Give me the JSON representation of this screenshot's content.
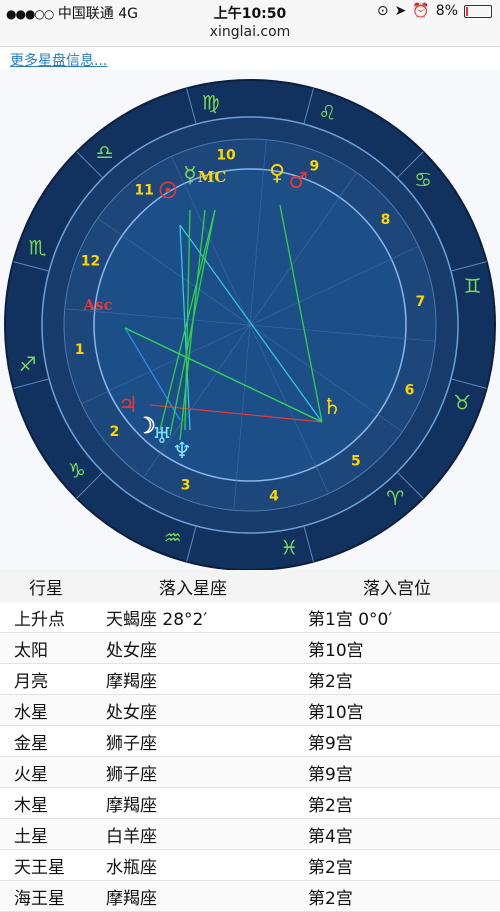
{
  "status": {
    "carrier": "中国联通",
    "network": "4G",
    "time": "上午10:50",
    "battery": "8%",
    "battery_level": 0.08
  },
  "url": "xinglai.com",
  "link_more": "更多星盘信息...",
  "chart": {
    "signs": [
      "♍",
      "♌",
      "♋",
      "♊",
      "♉",
      "♈",
      "♓",
      "♒",
      "♑",
      "♐",
      "♏",
      "♎"
    ],
    "house_numbers": [
      "1",
      "2",
      "3",
      "4",
      "5",
      "6",
      "7",
      "8",
      "9",
      "10",
      "11",
      "12"
    ],
    "planets": [
      {
        "glyph": "Asc",
        "color": "#e53935"
      },
      {
        "glyph": "☉",
        "color": "#e53935"
      },
      {
        "glyph": "MC",
        "color": "#ffd400"
      },
      {
        "glyph": "♀",
        "color": "#ffd400"
      },
      {
        "glyph": "♂",
        "color": "#e53935"
      },
      {
        "glyph": "☿",
        "color": "#7ed957"
      },
      {
        "glyph": "♃",
        "color": "#e53935"
      },
      {
        "glyph": "☽",
        "color": "#ffffff"
      },
      {
        "glyph": "♅",
        "color": "#7ee0ff"
      },
      {
        "glyph": "♆",
        "color": "#7ee0ff"
      },
      {
        "glyph": "♄",
        "color": "#ffd400"
      }
    ]
  },
  "table": {
    "headers": [
      "行星",
      "落入星座",
      "落入宫位"
    ],
    "rows": [
      [
        "上升点",
        "天蝎座 28°2′",
        "第1宫 0°0′"
      ],
      [
        "太阳",
        "处女座",
        "第10宫"
      ],
      [
        "月亮",
        "摩羯座",
        "第2宫"
      ],
      [
        "水星",
        "处女座",
        "第10宫"
      ],
      [
        "金星",
        "狮子座",
        "第9宫"
      ],
      [
        "火星",
        "狮子座",
        "第9宫"
      ],
      [
        "木星",
        "摩羯座",
        "第2宫"
      ],
      [
        "土星",
        "白羊座",
        "第4宫"
      ],
      [
        "天王星",
        "水瓶座",
        "第2宫"
      ],
      [
        "海王星",
        "摩羯座",
        "第2宫"
      ]
    ]
  }
}
